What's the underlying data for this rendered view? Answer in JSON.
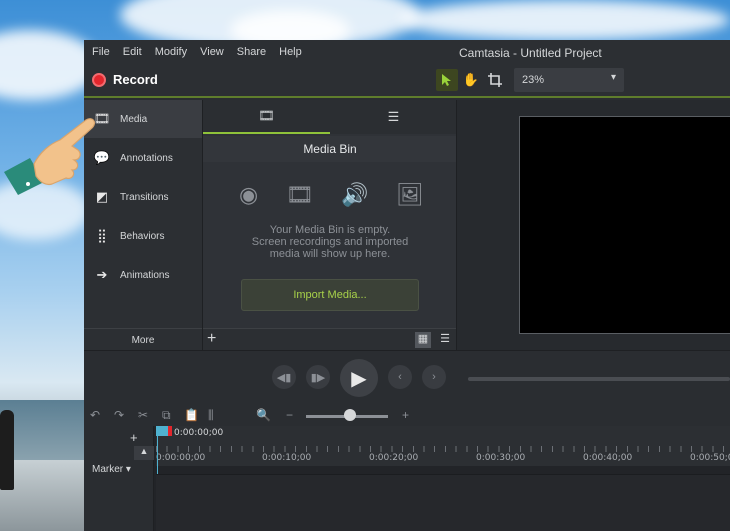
{
  "window": {
    "title": "Camtasia - Untitled Project"
  },
  "menu": [
    "File",
    "Edit",
    "Modify",
    "View",
    "Share",
    "Help"
  ],
  "toolbar": {
    "record_label": "Record",
    "zoom_value": "23%"
  },
  "sidebar": {
    "items": [
      {
        "label": "Media",
        "icon": "film-strip-icon"
      },
      {
        "label": "Annotations",
        "icon": "annotations-icon"
      },
      {
        "label": "Transitions",
        "icon": "transitions-icon"
      },
      {
        "label": "Behaviors",
        "icon": "behaviors-icon"
      },
      {
        "label": "Animations",
        "icon": "animations-icon"
      }
    ],
    "more_label": "More"
  },
  "media_bin": {
    "title": "Media Bin",
    "empty_message": [
      "Your Media Bin is empty.",
      "Screen recordings and imported",
      "media will show up here."
    ],
    "import_label": "Import Media..."
  },
  "timeline": {
    "playhead_time": "0:00:00;00",
    "marker_label": "Marker",
    "ticks": [
      "0:00:00;00",
      "0:00:10;00",
      "0:00:20;00",
      "0:00:30;00",
      "0:00:40;00",
      "0:00:50;0"
    ]
  },
  "colors": {
    "accent": "#8fc23a",
    "record": "#e3262d",
    "playhead": "#4fb1cf"
  }
}
